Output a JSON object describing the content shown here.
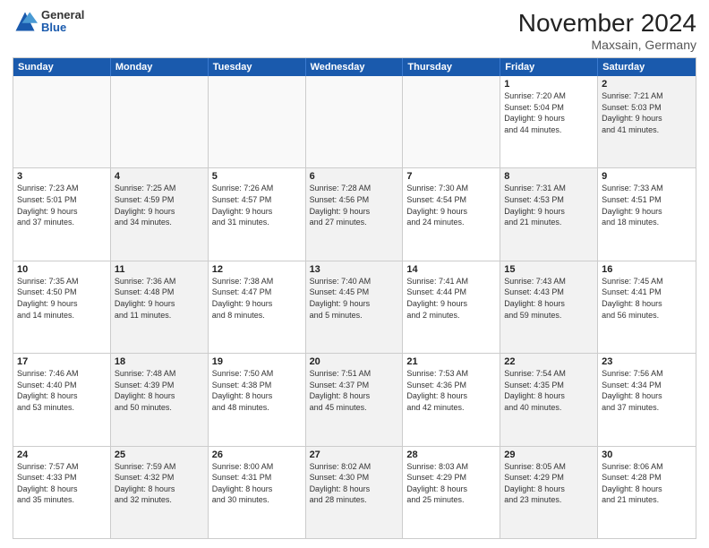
{
  "header": {
    "logo_general": "General",
    "logo_blue": "Blue",
    "title": "November 2024",
    "location": "Maxsain, Germany"
  },
  "weekdays": [
    "Sunday",
    "Monday",
    "Tuesday",
    "Wednesday",
    "Thursday",
    "Friday",
    "Saturday"
  ],
  "rows": [
    [
      {
        "day": "",
        "info": "",
        "shaded": false,
        "empty": true
      },
      {
        "day": "",
        "info": "",
        "shaded": false,
        "empty": true
      },
      {
        "day": "",
        "info": "",
        "shaded": false,
        "empty": true
      },
      {
        "day": "",
        "info": "",
        "shaded": false,
        "empty": true
      },
      {
        "day": "",
        "info": "",
        "shaded": false,
        "empty": true
      },
      {
        "day": "1",
        "info": "Sunrise: 7:20 AM\nSunset: 5:04 PM\nDaylight: 9 hours\nand 44 minutes.",
        "shaded": false,
        "empty": false
      },
      {
        "day": "2",
        "info": "Sunrise: 7:21 AM\nSunset: 5:03 PM\nDaylight: 9 hours\nand 41 minutes.",
        "shaded": true,
        "empty": false
      }
    ],
    [
      {
        "day": "3",
        "info": "Sunrise: 7:23 AM\nSunset: 5:01 PM\nDaylight: 9 hours\nand 37 minutes.",
        "shaded": false,
        "empty": false
      },
      {
        "day": "4",
        "info": "Sunrise: 7:25 AM\nSunset: 4:59 PM\nDaylight: 9 hours\nand 34 minutes.",
        "shaded": true,
        "empty": false
      },
      {
        "day": "5",
        "info": "Sunrise: 7:26 AM\nSunset: 4:57 PM\nDaylight: 9 hours\nand 31 minutes.",
        "shaded": false,
        "empty": false
      },
      {
        "day": "6",
        "info": "Sunrise: 7:28 AM\nSunset: 4:56 PM\nDaylight: 9 hours\nand 27 minutes.",
        "shaded": true,
        "empty": false
      },
      {
        "day": "7",
        "info": "Sunrise: 7:30 AM\nSunset: 4:54 PM\nDaylight: 9 hours\nand 24 minutes.",
        "shaded": false,
        "empty": false
      },
      {
        "day": "8",
        "info": "Sunrise: 7:31 AM\nSunset: 4:53 PM\nDaylight: 9 hours\nand 21 minutes.",
        "shaded": true,
        "empty": false
      },
      {
        "day": "9",
        "info": "Sunrise: 7:33 AM\nSunset: 4:51 PM\nDaylight: 9 hours\nand 18 minutes.",
        "shaded": false,
        "empty": false
      }
    ],
    [
      {
        "day": "10",
        "info": "Sunrise: 7:35 AM\nSunset: 4:50 PM\nDaylight: 9 hours\nand 14 minutes.",
        "shaded": false,
        "empty": false
      },
      {
        "day": "11",
        "info": "Sunrise: 7:36 AM\nSunset: 4:48 PM\nDaylight: 9 hours\nand 11 minutes.",
        "shaded": true,
        "empty": false
      },
      {
        "day": "12",
        "info": "Sunrise: 7:38 AM\nSunset: 4:47 PM\nDaylight: 9 hours\nand 8 minutes.",
        "shaded": false,
        "empty": false
      },
      {
        "day": "13",
        "info": "Sunrise: 7:40 AM\nSunset: 4:45 PM\nDaylight: 9 hours\nand 5 minutes.",
        "shaded": true,
        "empty": false
      },
      {
        "day": "14",
        "info": "Sunrise: 7:41 AM\nSunset: 4:44 PM\nDaylight: 9 hours\nand 2 minutes.",
        "shaded": false,
        "empty": false
      },
      {
        "day": "15",
        "info": "Sunrise: 7:43 AM\nSunset: 4:43 PM\nDaylight: 8 hours\nand 59 minutes.",
        "shaded": true,
        "empty": false
      },
      {
        "day": "16",
        "info": "Sunrise: 7:45 AM\nSunset: 4:41 PM\nDaylight: 8 hours\nand 56 minutes.",
        "shaded": false,
        "empty": false
      }
    ],
    [
      {
        "day": "17",
        "info": "Sunrise: 7:46 AM\nSunset: 4:40 PM\nDaylight: 8 hours\nand 53 minutes.",
        "shaded": false,
        "empty": false
      },
      {
        "day": "18",
        "info": "Sunrise: 7:48 AM\nSunset: 4:39 PM\nDaylight: 8 hours\nand 50 minutes.",
        "shaded": true,
        "empty": false
      },
      {
        "day": "19",
        "info": "Sunrise: 7:50 AM\nSunset: 4:38 PM\nDaylight: 8 hours\nand 48 minutes.",
        "shaded": false,
        "empty": false
      },
      {
        "day": "20",
        "info": "Sunrise: 7:51 AM\nSunset: 4:37 PM\nDaylight: 8 hours\nand 45 minutes.",
        "shaded": true,
        "empty": false
      },
      {
        "day": "21",
        "info": "Sunrise: 7:53 AM\nSunset: 4:36 PM\nDaylight: 8 hours\nand 42 minutes.",
        "shaded": false,
        "empty": false
      },
      {
        "day": "22",
        "info": "Sunrise: 7:54 AM\nSunset: 4:35 PM\nDaylight: 8 hours\nand 40 minutes.",
        "shaded": true,
        "empty": false
      },
      {
        "day": "23",
        "info": "Sunrise: 7:56 AM\nSunset: 4:34 PM\nDaylight: 8 hours\nand 37 minutes.",
        "shaded": false,
        "empty": false
      }
    ],
    [
      {
        "day": "24",
        "info": "Sunrise: 7:57 AM\nSunset: 4:33 PM\nDaylight: 8 hours\nand 35 minutes.",
        "shaded": false,
        "empty": false
      },
      {
        "day": "25",
        "info": "Sunrise: 7:59 AM\nSunset: 4:32 PM\nDaylight: 8 hours\nand 32 minutes.",
        "shaded": true,
        "empty": false
      },
      {
        "day": "26",
        "info": "Sunrise: 8:00 AM\nSunset: 4:31 PM\nDaylight: 8 hours\nand 30 minutes.",
        "shaded": false,
        "empty": false
      },
      {
        "day": "27",
        "info": "Sunrise: 8:02 AM\nSunset: 4:30 PM\nDaylight: 8 hours\nand 28 minutes.",
        "shaded": true,
        "empty": false
      },
      {
        "day": "28",
        "info": "Sunrise: 8:03 AM\nSunset: 4:29 PM\nDaylight: 8 hours\nand 25 minutes.",
        "shaded": false,
        "empty": false
      },
      {
        "day": "29",
        "info": "Sunrise: 8:05 AM\nSunset: 4:29 PM\nDaylight: 8 hours\nand 23 minutes.",
        "shaded": true,
        "empty": false
      },
      {
        "day": "30",
        "info": "Sunrise: 8:06 AM\nSunset: 4:28 PM\nDaylight: 8 hours\nand 21 minutes.",
        "shaded": false,
        "empty": false
      }
    ]
  ]
}
